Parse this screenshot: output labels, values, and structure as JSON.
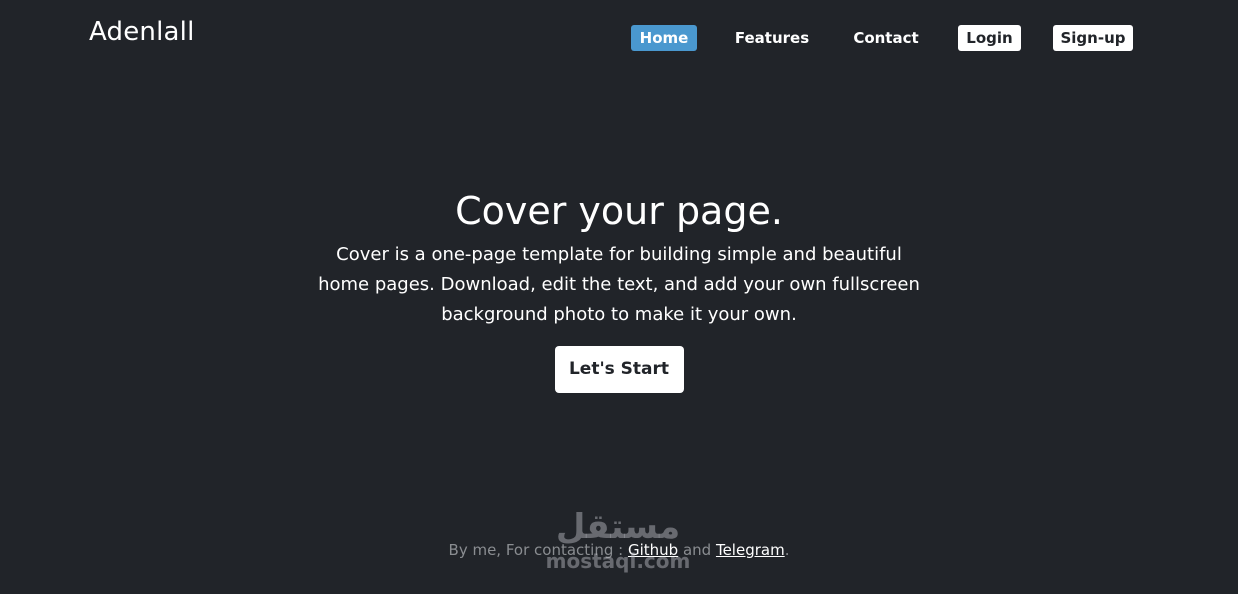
{
  "header": {
    "brand": "Adenlall",
    "nav": {
      "home": "Home",
      "features": "Features",
      "contact": "Contact",
      "login": "Login",
      "signup": "Sign-up"
    }
  },
  "hero": {
    "title": "Cover your page.",
    "text": "Cover is a one-page template for building simple and beautiful home pages. Download, edit the text, and add your own fullscreen background photo to make it your own.",
    "cta_label": "Let's Start"
  },
  "footer": {
    "prefix": "By me, For contacting : ",
    "github": "Github",
    "and": " and ",
    "telegram": "Telegram",
    "suffix": "."
  },
  "watermark": {
    "arabic": "مستقل",
    "latin": "mostaql.com"
  },
  "colors": {
    "background": "#212429",
    "accent": "#4a98cf",
    "text": "#ffffff",
    "muted": "#8a8d91"
  }
}
